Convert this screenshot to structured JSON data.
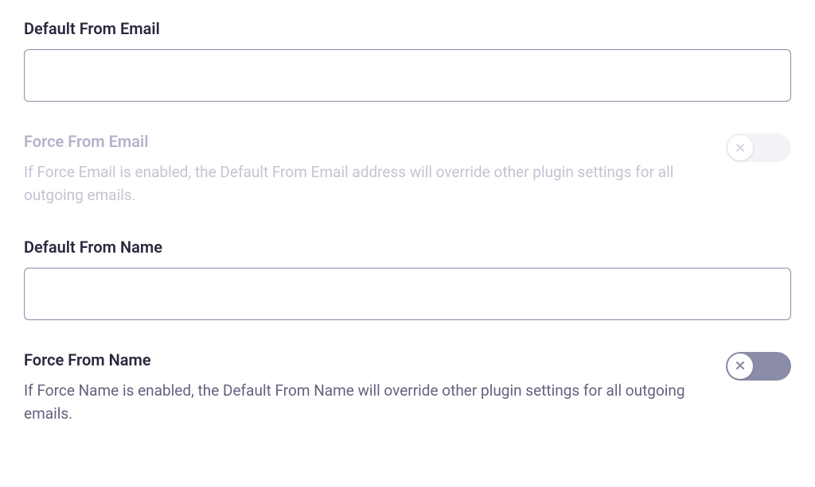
{
  "fields": {
    "default_from_email": {
      "label": "Default From Email",
      "value": ""
    },
    "force_from_email": {
      "label": "Force From Email",
      "description": "If Force Email is enabled, the Default From Email address will override other plugin settings for all outgoing emails.",
      "enabled": false
    },
    "default_from_name": {
      "label": "Default From Name",
      "value": ""
    },
    "force_from_name": {
      "label": "Force From Name",
      "description": "If Force Name is enabled, the Default From Name will override other plugin settings for all outgoing emails.",
      "enabled": true
    }
  }
}
